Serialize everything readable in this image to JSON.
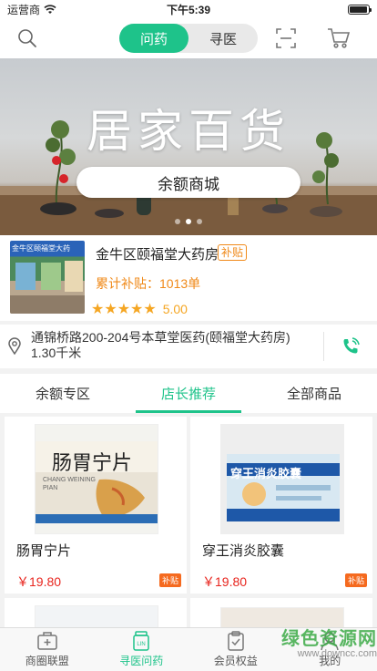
{
  "status_bar": {
    "carrier": "运营商",
    "time": "下午5:39",
    "battery_level": 0.95
  },
  "header": {
    "tabs": [
      "问药",
      "寻医"
    ],
    "active_tab": 0
  },
  "banner": {
    "title": "居家百货",
    "button_label": "余额商城",
    "slide_count": 3,
    "active_slide": 1
  },
  "store": {
    "name": "金牛区颐福堂大药房",
    "badge": "补贴",
    "sign_text": "金牛区颐福堂大药",
    "subsidy": "累计补贴：1013单",
    "stars": 5,
    "rating": "5.00"
  },
  "address": {
    "text": "通锦桥路200-204号本草堂医药(颐福堂大药房)",
    "distance": "1.30千米"
  },
  "tabs": [
    "余额专区",
    "店长推荐",
    "全部商品"
  ],
  "active_tab": 1,
  "products": [
    {
      "name": "肠胃宁片",
      "price": "￥19.80",
      "badge": "补贴",
      "box_text": "肠胃宁片",
      "box_sub": "CHANG WEINING PIAN"
    },
    {
      "name": "穿王消炎胶囊",
      "price": "￥19.80",
      "badge": "补贴",
      "box_text": "穿王消炎胶囊"
    }
  ],
  "bottom_nav": [
    {
      "label": "商圈联盟",
      "icon": "medical-kit-icon"
    },
    {
      "label": "寻医问药",
      "icon": "medicine-bottle-icon"
    },
    {
      "label": "会员权益",
      "icon": "clipboard-check-icon"
    },
    {
      "label": "我的",
      "icon": "user-icon"
    }
  ],
  "active_nav": 1,
  "watermark": {
    "main": "绿色资源网",
    "sub": "www.downcc.com"
  },
  "colors": {
    "accent": "#1ec38a",
    "orange": "#f08a1a",
    "price_red": "#e8251e"
  }
}
